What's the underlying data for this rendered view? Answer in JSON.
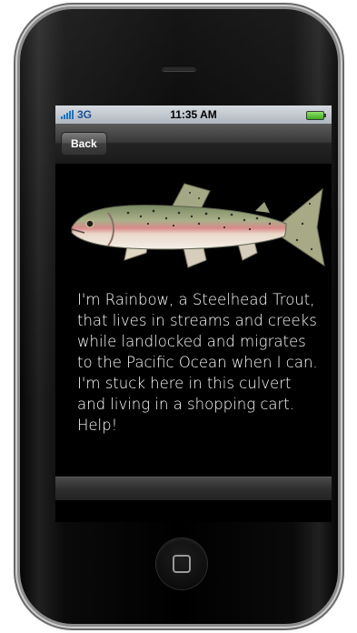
{
  "status_bar": {
    "carrier": "3G",
    "time": "11:35 AM"
  },
  "nav": {
    "back_label": "Back"
  },
  "content": {
    "image_icon": "rainbow-trout-illustration",
    "message": "I'm Rainbow, a Steelhead Trout, that lives in streams and creeks while landlocked and migrates to the Pacific Ocean when I can. I'm stuck here in this culvert and living in a shopping cart. Help!"
  },
  "colors": {
    "screen_background": "#000000",
    "text": "#ffffff",
    "battery": "#3cae1e",
    "signal": "#1a73c9"
  }
}
